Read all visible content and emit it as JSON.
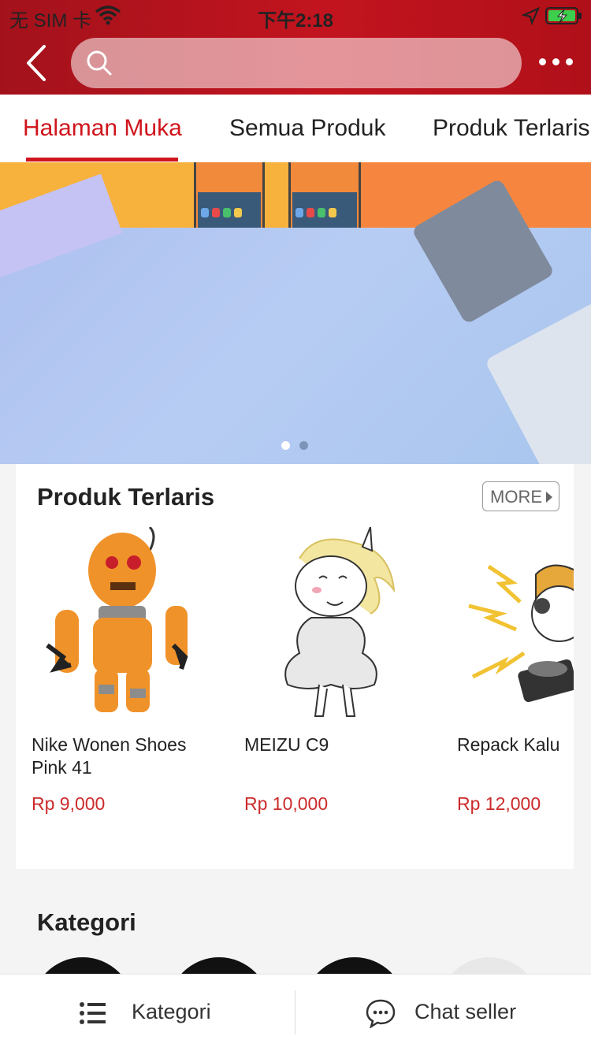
{
  "status_bar": {
    "carrier": "无 SIM 卡",
    "time": "下午2:18"
  },
  "header": {
    "search_placeholder": "",
    "accent_color": "#c2141f"
  },
  "tabs": [
    {
      "label": "Halaman Muka",
      "active": true
    },
    {
      "label": "Semua Produk",
      "active": false
    },
    {
      "label": "Produk Terlaris",
      "active": false
    }
  ],
  "banner": {
    "pages": 2,
    "active_page": 2
  },
  "best_sellers": {
    "title": "Produk Terlaris",
    "more_label": "MORE",
    "products": [
      {
        "name": "Nike Wonen Shoes Pink 41",
        "price": "Rp 9,000",
        "image": "orange-robot-toy"
      },
      {
        "name": "MEIZU C9",
        "price": "Rp 10,000",
        "image": "unicorn-sticker"
      },
      {
        "name": "Repack Kalu",
        "price": "Rp 12,000",
        "image": "dj-unicorn-sticker"
      }
    ]
  },
  "categories": {
    "title": "Kategori"
  },
  "bottom_bar": {
    "category_label": "Kategori",
    "chat_label": "Chat seller",
    "category_icon": "list-icon",
    "chat_icon": "chat-bubble-icon"
  }
}
